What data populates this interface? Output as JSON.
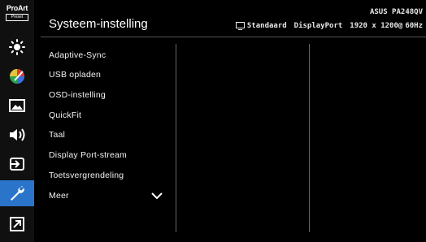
{
  "sidebar": {
    "logo_line1": "ProArt",
    "logo_line2": "Preset",
    "icons": [
      "brightness-icon",
      "color-icon",
      "image-icon",
      "sound-icon",
      "input-select-icon",
      "system-setup-icon",
      "shortcut-icon"
    ],
    "active_index": 5,
    "accent_color": "#2a74c9"
  },
  "header": {
    "title": "Systeem-instelling",
    "model": "ASUS PA248QV",
    "mode": "Standaard",
    "input": "DisplayPort",
    "resolution": "1920 x 1200@",
    "refresh": "60Hz"
  },
  "menu": {
    "items": [
      "Adaptive-Sync",
      "USB opladen",
      "OSD-instelling",
      "QuickFit",
      "Taal",
      "Display Port-stream",
      "Toetsvergrendeling",
      "Meer"
    ]
  }
}
